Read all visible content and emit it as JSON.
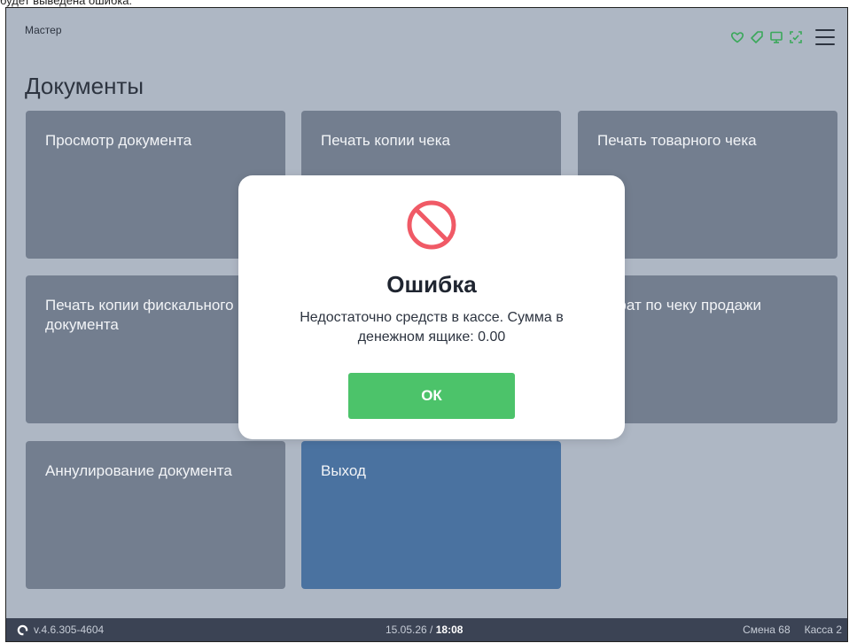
{
  "caption": "будет выведена ошибка:",
  "header": {
    "user": "Мастер",
    "status_icons": [
      "heart-icon",
      "tag-icon",
      "monitor-icon",
      "scanner-icon"
    ],
    "menu_icon": "hamburger-menu-icon"
  },
  "page_title": "Документы",
  "tiles": [
    {
      "label": "Просмотр документа"
    },
    {
      "label": "Печать копии чека"
    },
    {
      "label": "Печать товарного чека"
    },
    {
      "label": "Печать копии фискального документа"
    },
    {
      "label": ""
    },
    {
      "label": "Возврат по чеку продажи"
    },
    {
      "label": "Аннулирование документа"
    },
    {
      "label": "Выход"
    }
  ],
  "dialog": {
    "icon": "prohibited-icon",
    "title": "Ошибка",
    "message": "Недостаточно средств в кассе. Сумма в денежном ящике: 0.00",
    "ok_label": "ОК"
  },
  "footer": {
    "version": "v.4.6.305-4604",
    "date": "15.05.26",
    "separator": " / ",
    "time": "18:08",
    "shift": "Смена 68",
    "register": "Касса 2"
  },
  "colors": {
    "background": "#aeb7c4",
    "tile": "#737e8f",
    "exit_tile": "#4a72a0",
    "ok_button": "#4cc36a",
    "error_icon": "#f05a66",
    "status_icons": "#3aa85a",
    "footer": "#3b4354"
  }
}
